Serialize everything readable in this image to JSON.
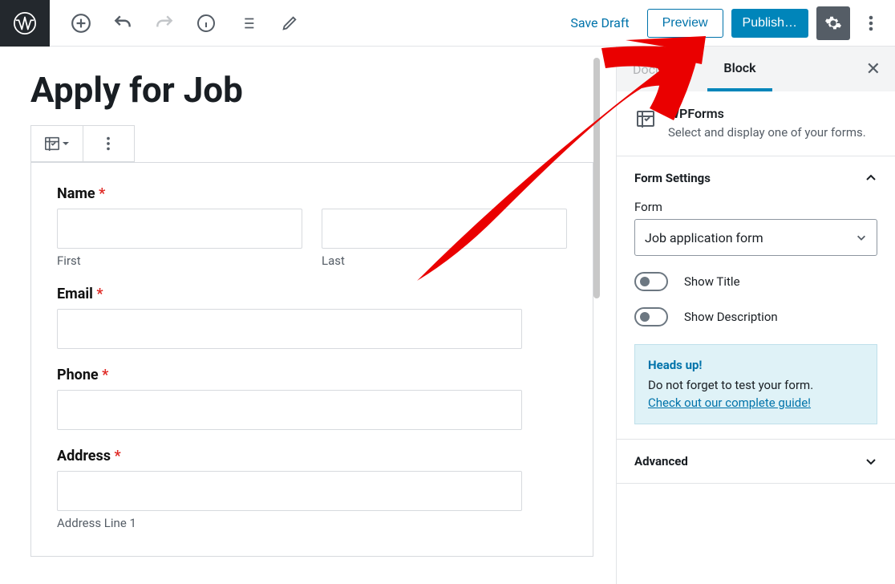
{
  "toolbar": {
    "save_draft": "Save Draft",
    "preview": "Preview",
    "publish": "Publish…"
  },
  "page": {
    "title": "Apply for Job"
  },
  "form": {
    "name_label": "Name",
    "first_label": "First",
    "last_label": "Last",
    "email_label": "Email",
    "phone_label": "Phone",
    "address_label": "Address",
    "addr1_label": "Address Line 1",
    "required_mark": "*"
  },
  "sidebar": {
    "tab_document": "Document",
    "tab_block": "Block",
    "block_title": "WPForms",
    "block_desc": "Select and display one of your forms.",
    "form_settings_title": "Form Settings",
    "form_label": "Form",
    "form_selected": "Job application form",
    "show_title": "Show Title",
    "show_description": "Show Description",
    "callout_head": "Heads up!",
    "callout_body": "Do not forget to test your form.",
    "callout_link": "Check out our complete guide!",
    "advanced_title": "Advanced"
  }
}
